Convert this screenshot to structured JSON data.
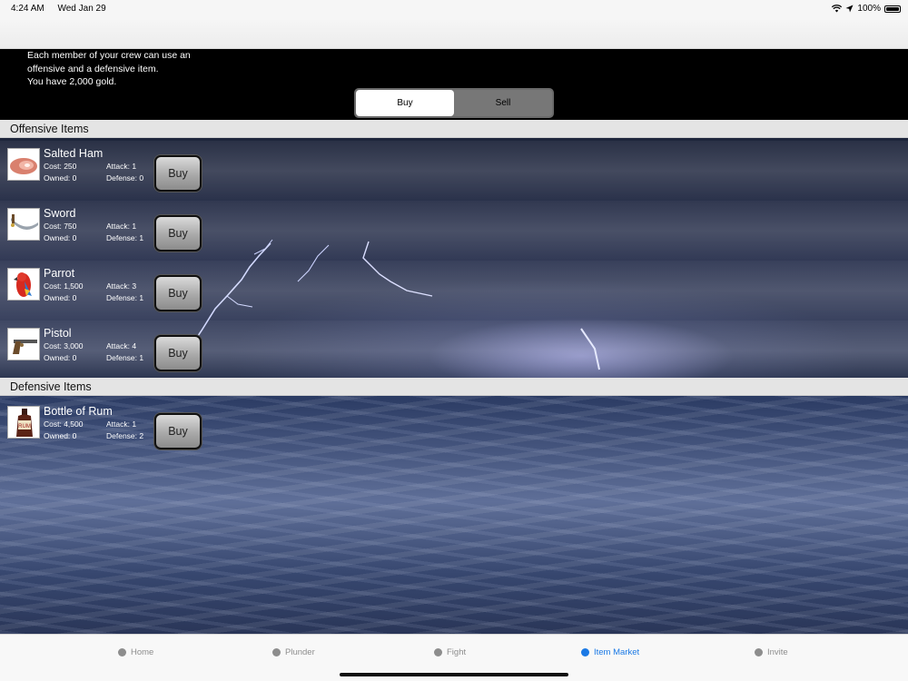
{
  "status_bar": {
    "time": "4:24 AM",
    "date": "Wed Jan 29",
    "battery": "100%"
  },
  "header": {
    "intro_lines": [
      "Each member of your crew can use an",
      "offensive and a defensive item.",
      "You have 2,000 gold."
    ],
    "segment_buy": "Buy",
    "segment_sell": "Sell",
    "selected_segment": "Buy"
  },
  "offensive": {
    "title": "Offensive Items",
    "items": [
      {
        "name": "Salted Ham",
        "cost": "Cost: 250",
        "owned": "Owned: 0",
        "attack": "Attack: 1",
        "defense": "Defense: 0",
        "button": "Buy",
        "icon": "ham-icon"
      },
      {
        "name": "Sword",
        "cost": "Cost: 750",
        "owned": "Owned: 0",
        "attack": "Attack: 1",
        "defense": "Defense: 1",
        "button": "Buy",
        "icon": "sword-icon"
      },
      {
        "name": "Parrot",
        "cost": "Cost: 1,500",
        "owned": "Owned: 0",
        "attack": "Attack: 3",
        "defense": "Defense: 1",
        "button": "Buy",
        "icon": "parrot-icon"
      },
      {
        "name": "Pistol",
        "cost": "Cost: 3,000",
        "owned": "Owned: 0",
        "attack": "Attack: 4",
        "defense": "Defense: 1",
        "button": "Buy",
        "icon": "pistol-icon"
      }
    ]
  },
  "defensive": {
    "title": "Defensive Items",
    "items": [
      {
        "name": "Bottle of Rum",
        "cost": "Cost: 4,500",
        "owned": "Owned: 0",
        "attack": "Attack: 1",
        "defense": "Defense: 2",
        "button": "Buy",
        "icon": "rum-bottle-icon",
        "label": "RUM"
      }
    ]
  },
  "tabs": [
    {
      "label": "Home",
      "active": false
    },
    {
      "label": "Plunder",
      "active": false
    },
    {
      "label": "Fight",
      "active": false
    },
    {
      "label": "Item Market",
      "active": true
    },
    {
      "label": "Invite",
      "active": false
    }
  ],
  "colors": {
    "active_tab": "#1a79e5",
    "inactive_tab": "#8d8d8d"
  }
}
